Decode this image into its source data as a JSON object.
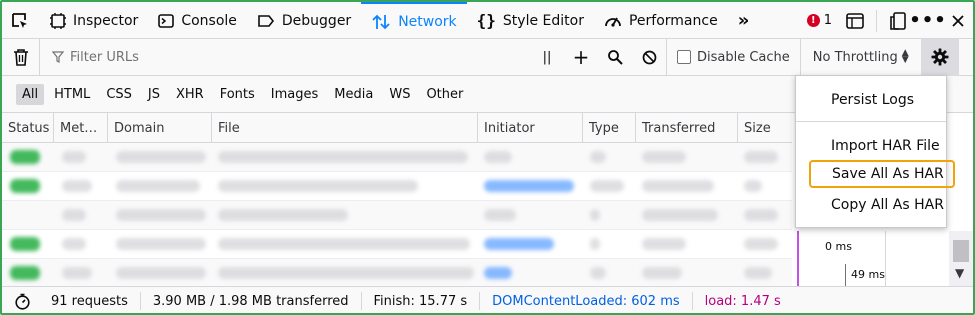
{
  "toolbar": {
    "tabs": [
      {
        "label": "Inspector",
        "icon": "inspector-icon"
      },
      {
        "label": "Console",
        "icon": "console-icon"
      },
      {
        "label": "Debugger",
        "icon": "debugger-icon"
      },
      {
        "label": "Network",
        "icon": "network-icon",
        "selected": true
      },
      {
        "label": "Style Editor",
        "icon": "style-editor-icon"
      },
      {
        "label": "Performance",
        "icon": "performance-icon"
      }
    ],
    "error_count": "1",
    "accent": "#0a84ff"
  },
  "filterbar": {
    "placeholder": "Filter URLs",
    "disable_cache_label": "Disable Cache",
    "throttling_label": "No Throttling"
  },
  "type_filters": [
    "All",
    "HTML",
    "CSS",
    "JS",
    "XHR",
    "Fonts",
    "Images",
    "Media",
    "WS",
    "Other"
  ],
  "columns": [
    "Status",
    "Met…",
    "Domain",
    "File",
    "Initiator",
    "Type",
    "Transferred",
    "Size"
  ],
  "menu": {
    "persist_logs": "Persist Logs",
    "import_har": "Import HAR File",
    "save_all_har": "Save All As HAR",
    "copy_all_har": "Copy All As HAR"
  },
  "waterfall": {
    "label_start": "0 ms",
    "label_mid": "49 ms"
  },
  "statusbar": {
    "requests": "91 requests",
    "transferred": "3.90 MB / 1.98 MB transferred",
    "finish": "Finish: 15.77 s",
    "dom_content_loaded": "DOMContentLoaded: 602 ms",
    "load": "load: 1.47 s"
  },
  "colors": {
    "status_ok": "#30b24c",
    "dom_content_loaded": "#0060df",
    "load": "#b5007f",
    "highlight": "#f0a30a"
  }
}
